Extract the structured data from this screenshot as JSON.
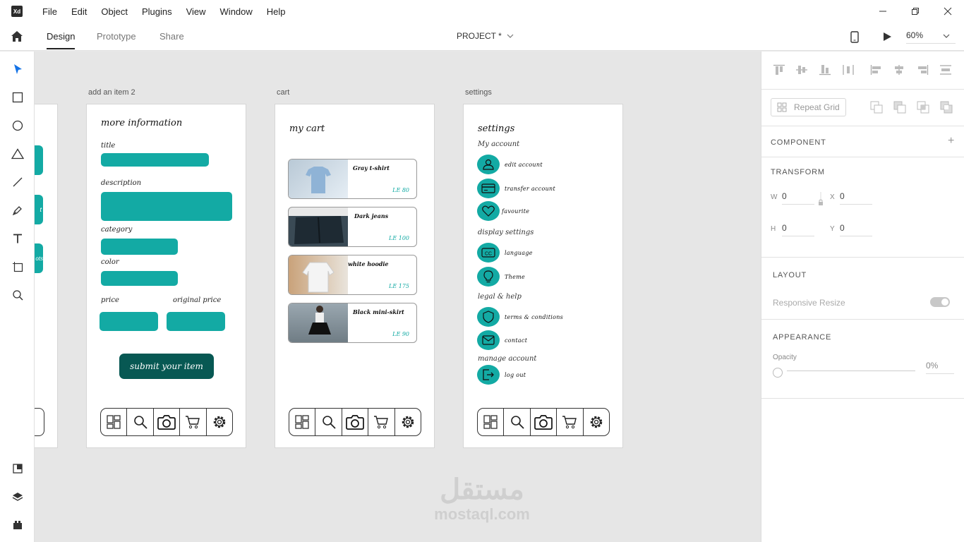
{
  "app": {
    "logo": "Xd"
  },
  "menu": [
    "File",
    "Edit",
    "Object",
    "Plugins",
    "View",
    "Window",
    "Help"
  ],
  "tabs": [
    {
      "label": "Design",
      "active": true
    },
    {
      "label": "Prototype",
      "active": false
    },
    {
      "label": "Share",
      "active": false
    }
  ],
  "project": {
    "name": "PROJECT *"
  },
  "zoom": {
    "value": "60%"
  },
  "artboards": {
    "add_item": {
      "label": "add an item 2",
      "title": "more information",
      "fields": {
        "title": "title",
        "description": "description",
        "category": "category",
        "color": "color",
        "price": "price",
        "original_price": "original price"
      },
      "submit": "submit your item"
    },
    "cart": {
      "label": "cart",
      "title": "my cart",
      "items": [
        {
          "name": "Gray t-shirt",
          "price": "LE 80"
        },
        {
          "name": "Dark jeans",
          "price": "LE 100"
        },
        {
          "name": "white hoodie",
          "price": "LE 175"
        },
        {
          "name": "Black mini-skirt",
          "price": "LE 90"
        }
      ]
    },
    "settings": {
      "label": "settings",
      "title": "settings",
      "sections": {
        "my_account": "My account",
        "display": "display settings",
        "legal": "legal & help",
        "manage": "manage account"
      },
      "items": {
        "edit": "edit account",
        "transfer": "transfer account",
        "favourite": "favourite",
        "language": "language",
        "theme": "Theme",
        "terms": "terms & conditions",
        "contact": "contact",
        "logout": "log out"
      }
    },
    "partial": {
      "btn_text_1": "t",
      "btn_text_2": "ots"
    }
  },
  "props": {
    "repeat_grid": "Repeat Grid",
    "component": "COMPONENT",
    "transform": "TRANSFORM",
    "w_label": "W",
    "w": "0",
    "x_label": "X",
    "x": "0",
    "h_label": "H",
    "h": "0",
    "y_label": "Y",
    "y": "0",
    "layout": "LAYOUT",
    "responsive": "Responsive Resize",
    "appearance": "APPEARANCE",
    "opacity_label": "Opacity",
    "opacity": "0%"
  },
  "watermark": {
    "arabic": "مستقل",
    "latin": "mostaql.com"
  },
  "colors": {
    "accent": "#13aaa4",
    "dark_accent": "#075853",
    "xd_select": "#1473e6"
  }
}
